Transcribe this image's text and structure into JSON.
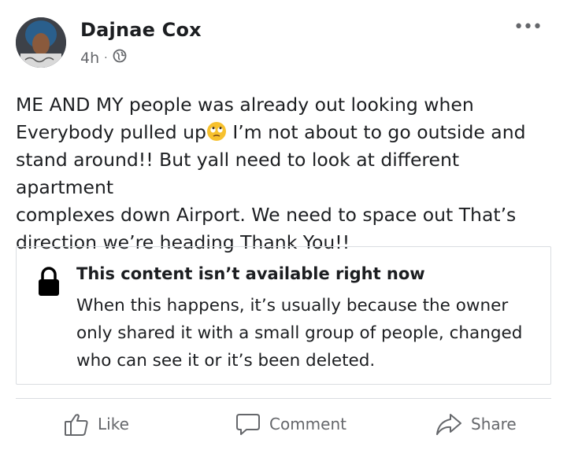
{
  "post": {
    "author": "Dajnae Cox",
    "time": "4h",
    "separator": "·",
    "text_before_emoji": "ME AND MY people was already out looking when\nEverybody pulled up",
    "text_after_emoji": " I’m not about to go outside and\nstand around!! But yall need to look at different apartment\ncomplexes down Airport. We need to space out That’s\ndirection we’re heading Thank You!!",
    "more_icon": "•••"
  },
  "unavailable": {
    "title": "This content isn’t available right now",
    "description": "When this happens, it’s usually because the owner only shared it with a small group of people, changed who can see it or it’s been deleted."
  },
  "actions": {
    "like": "Like",
    "comment": "Comment",
    "share": "Share"
  },
  "icons": {
    "audience": "globe-icon",
    "emoji": "eye-roll-emoji-icon",
    "lock": "lock-icon"
  }
}
